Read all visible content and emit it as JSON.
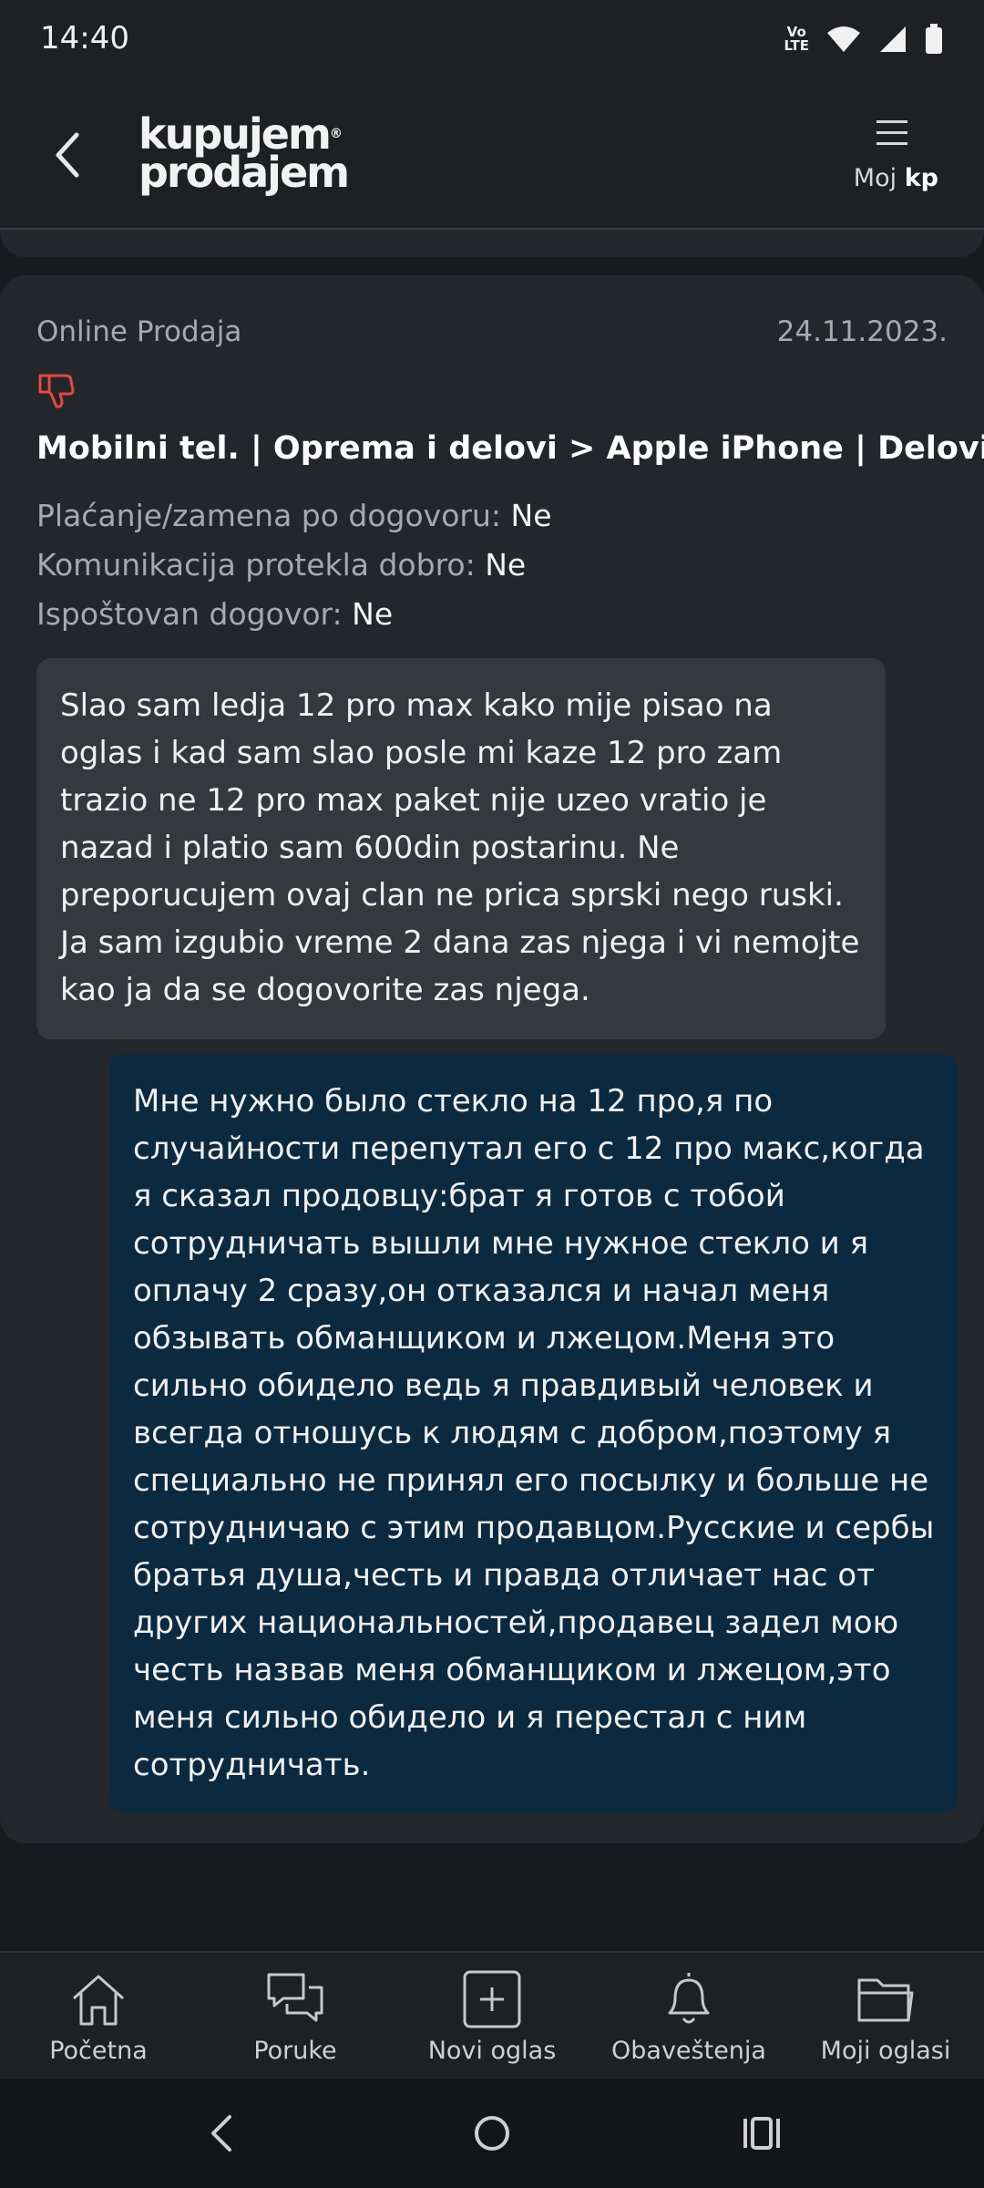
{
  "status_bar": {
    "time": "14:40",
    "volte_top": "Vo",
    "volte_bottom": "LTE"
  },
  "header": {
    "logo_line1": "kupujem",
    "logo_line2": "prodajem",
    "menu_label_prefix": "Moj",
    "menu_label_bold": "kp"
  },
  "review": {
    "type": "Online Prodaja",
    "date": "24.11.2023.",
    "rating_icon": "thumbs-down-icon",
    "category": "Mobilni tel. | Oprema i delovi > Apple iPhone | Delovi",
    "details": [
      {
        "label": "Plaćanje/zamena po dogovoru:",
        "value": "Ne"
      },
      {
        "label": "Komunikacija protekla dobro:",
        "value": "Ne"
      },
      {
        "label": "Ispoštovan dogovor:",
        "value": "Ne"
      }
    ],
    "comment": "Slao sam ledja 12 pro max kako mije pisao na oglas i kad sam slao posle mi kaze 12 pro zam trazio ne 12 pro max paket nije uzeo vratio je nazad i platio sam 600din postarinu. Ne preporucujem ovaj clan ne prica sprski nego ruski. Ja sam izgubio vreme 2 dana zas njega i vi nemojte kao ja da se dogovorite zas njega.",
    "reply": "Мне нужно было стекло на 12 про,я по случайности перепутал его с 12 про макс,когда я сказал продовцу:брат я готов с тобой сотрудничать вышли мне нужное стекло и я оплачу 2 сразу,он отказался и начал меня обзывать обманщиком и лжецом.Меня это сильно обидело ведь я правдивый человек и всегда отношусь к людям с добром,поэтому я специально не принял его посылку и больше не сотрудничаю с этим продавцом.Русские и сербы братья душа,честь и правда отличает нас от других национальностей,продавец задел мою честь назвав меня обманщиком и лжецом,это меня сильно обидело и я перестал с ним сотрудничать."
  },
  "bottom_nav": [
    {
      "label": "Početna",
      "icon": "home-icon"
    },
    {
      "label": "Poruke",
      "icon": "chat-icon"
    },
    {
      "label": "Novi oglas",
      "icon": "add-icon"
    },
    {
      "label": "Obaveštenja",
      "icon": "bell-icon"
    },
    {
      "label": "Moji oglasi",
      "icon": "folder-icon"
    }
  ],
  "colors": {
    "background": "#181a1d",
    "card": "#23262a",
    "comment_bubble": "#35383d",
    "reply_bubble": "#0b2a40",
    "negative": "#e5483f"
  }
}
